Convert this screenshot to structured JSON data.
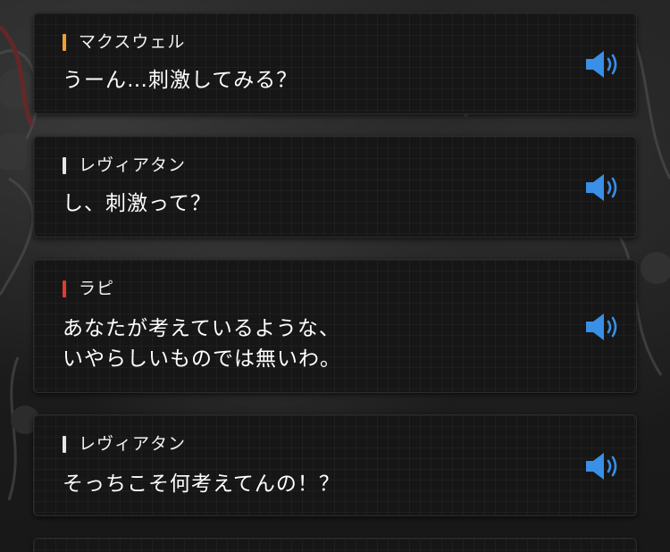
{
  "colors": {
    "maxwell": "#f0a030",
    "leviathan": "#e6e6e6",
    "rapi": "#e03a32",
    "voice_icon": "#3a8fe6"
  },
  "log": [
    {
      "speaker": "マクスウェル",
      "speaker_color": "maxwell",
      "text": "うーん…刺激してみる？"
    },
    {
      "speaker": "レヴィアタン",
      "speaker_color": "leviathan",
      "text": "し、刺激って？"
    },
    {
      "speaker": "ラピ",
      "speaker_color": "rapi",
      "text": "あなたが考えているような、\nいやらしいものでは無いわ。"
    },
    {
      "speaker": "レヴィアタン",
      "speaker_color": "leviathan",
      "text": "そっちこそ何考えてんの！？"
    }
  ],
  "voice_icon": "speaker-volume-icon"
}
